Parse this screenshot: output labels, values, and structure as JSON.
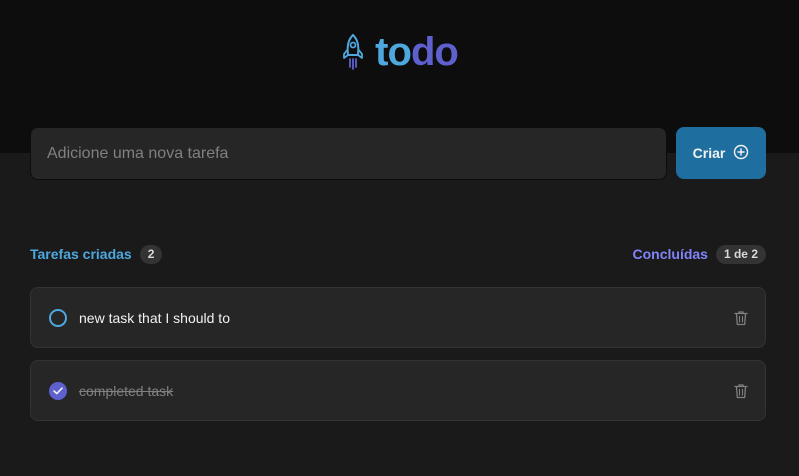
{
  "header": {
    "logo_icon": "rocket-icon",
    "logo_part1": "to",
    "logo_part2": "do",
    "colors": {
      "blue": "#4ea8de",
      "purple": "#5e60ce"
    }
  },
  "add_task": {
    "placeholder": "Adicione uma nova tarefa",
    "value": "",
    "button_label": "Criar",
    "button_icon": "plus-circle-icon",
    "button_color": "#1e6f9f"
  },
  "counters": {
    "created_label": "Tarefas criadas",
    "created_count": "2",
    "done_label": "Concluídas",
    "done_count": "1 de 2"
  },
  "tasks": [
    {
      "text": "new task that I should to",
      "completed": false,
      "delete_icon": "trash-icon"
    },
    {
      "text": "completed task",
      "completed": true,
      "delete_icon": "trash-icon"
    }
  ]
}
